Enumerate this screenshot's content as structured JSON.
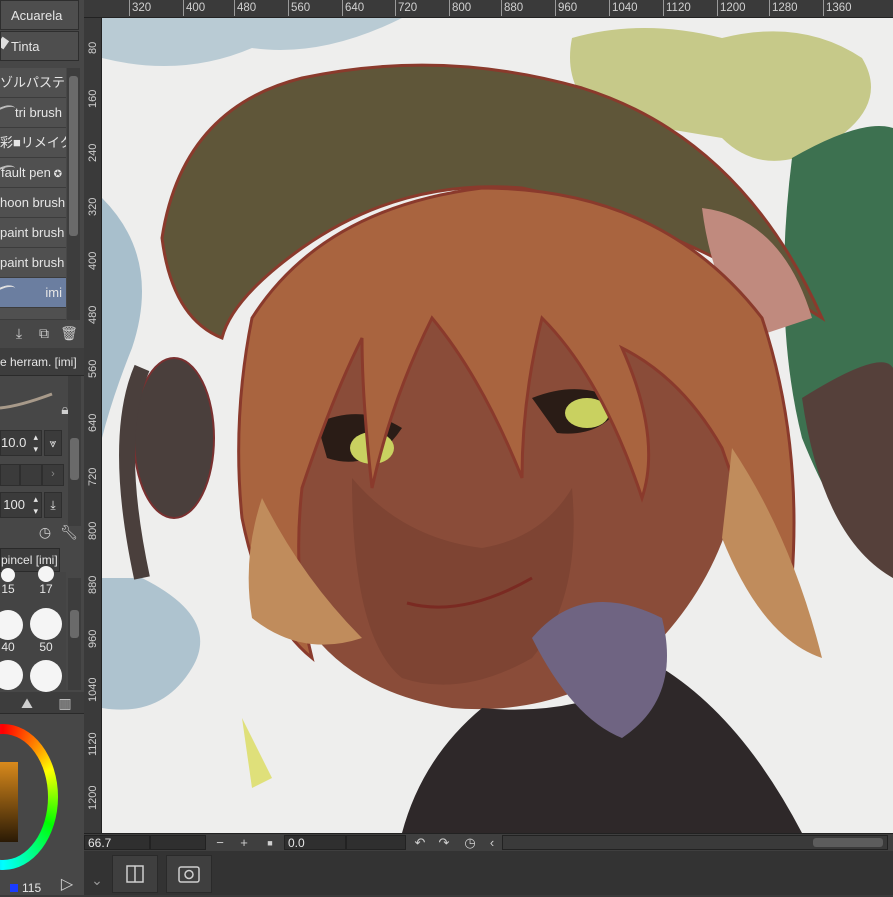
{
  "brush_sublist": {
    "items": [
      {
        "label": "Acuarela"
      },
      {
        "label": "Tinta"
      },
      {
        "label": "ゾルパステル"
      },
      {
        "label": "tri brush"
      },
      {
        "label": "彩■リメイク"
      },
      {
        "label": "fault pen"
      },
      {
        "label": "hoon brush"
      },
      {
        "label": "paint brush"
      },
      {
        "label": "paint brush"
      },
      {
        "label": "imi"
      }
    ]
  },
  "tool_property": {
    "title": "e herram. [imi]",
    "size_value": "10.0",
    "opacity_value": "100"
  },
  "brush_size_palette": {
    "title": "pincel [imi]",
    "sizes": [
      "15",
      "17",
      "40",
      "50"
    ]
  },
  "color": {
    "value_text": "115",
    "accent": "#6b7ea0",
    "main_color": "#c4741f"
  },
  "navigator": {
    "zoom": "66.7",
    "rotation": "0.0"
  },
  "ruler": {
    "horizontal": [
      "320",
      "400",
      "480",
      "560",
      "640",
      "720",
      "800",
      "880",
      "960",
      "1040",
      "1120",
      "1200",
      "1280",
      "1360"
    ],
    "vertical": [
      "80",
      "160",
      "240",
      "320",
      "400",
      "480",
      "560",
      "640",
      "720",
      "800",
      "880",
      "960",
      "1040",
      "1120",
      "1200"
    ]
  },
  "icons": {
    "lock": "lock-icon",
    "wrench": "wrench-icon",
    "rotate_left": "rotate-left-icon",
    "rotate_right": "rotate-right-icon"
  }
}
